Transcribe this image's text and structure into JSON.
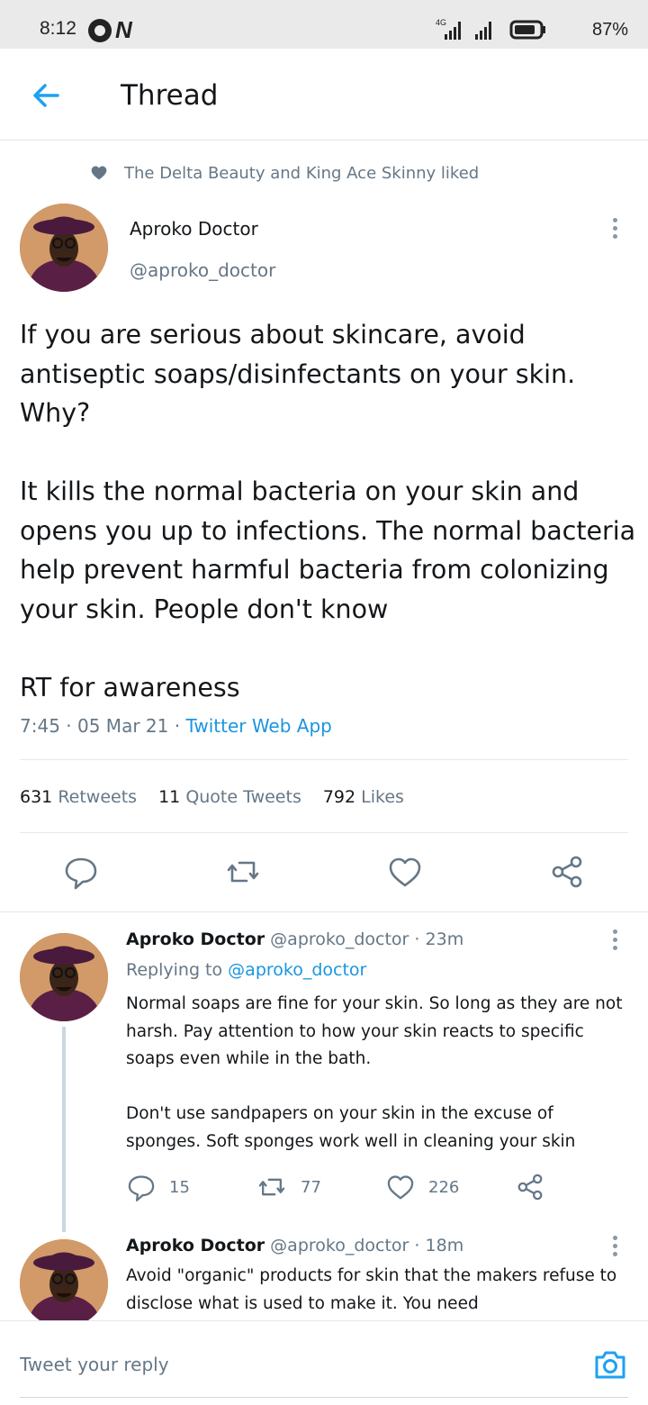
{
  "status_bar": {
    "time": "8:12",
    "network": "4G",
    "battery": "87%"
  },
  "header": {
    "title": "Thread"
  },
  "social_context": "The Delta Beauty and King Ace Skinny liked",
  "main_tweet": {
    "name": "Aproko Doctor",
    "handle": "@aproko_doctor",
    "para1": "If you are serious about skincare, avoid antiseptic soaps/disinfectants on your skin. Why?",
    "para2": "It kills the normal bacteria on your skin and opens you up to infections. The normal bacteria help prevent harmful bacteria from colonizing your skin. People don't know",
    "para3": "RT for awareness",
    "time": "7:45",
    "date": "05 Mar 21",
    "app": "Twitter Web App",
    "stats": {
      "retweets_count": "631",
      "retweets_label": "Retweets",
      "quotes_count": "11",
      "quotes_label": "Quote Tweets",
      "likes_count": "792",
      "likes_label": "Likes"
    }
  },
  "replies": [
    {
      "name": "Aproko Doctor",
      "handle": "@aproko_doctor",
      "age": "23m",
      "replying_prefix": "Replying to",
      "replying_to": "@aproko_doctor",
      "text": "Normal soaps are fine for your skin. So long as they are not harsh. Pay attention to how your skin reacts to specific soaps even while in the bath.\n\nDon't use sandpapers on your skin in the excuse of sponges. Soft sponges work well in cleaning your skin",
      "reply_count": "15",
      "retweet_count": "77",
      "like_count": "226"
    },
    {
      "name": "Aproko Doctor",
      "handle": "@aproko_doctor",
      "age": "18m",
      "text": "Avoid \"organic\" products for skin that the makers refuse to disclose what is used to make it. You need"
    }
  ],
  "composer": {
    "placeholder": "Tweet your reply"
  },
  "colors": {
    "accent": "#1da1f2",
    "link": "#1b95e0",
    "muted": "#657786",
    "text": "#14171a",
    "divider": "#e1e8ed"
  },
  "icons": [
    "back-arrow-icon",
    "heart-icon",
    "more-icon",
    "reply-icon",
    "retweet-icon",
    "like-icon",
    "share-icon",
    "camera-icon"
  ]
}
